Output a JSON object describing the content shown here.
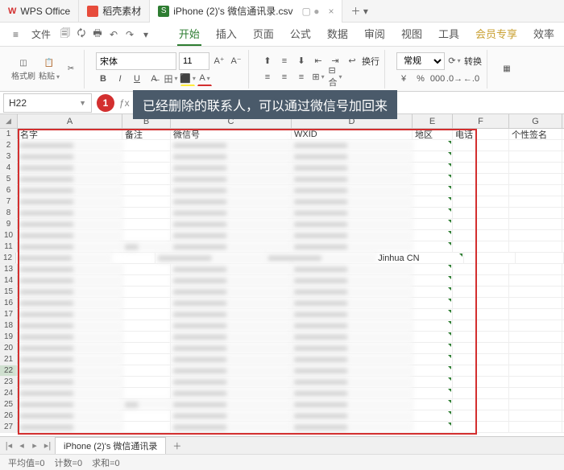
{
  "tabs": {
    "app1": "WPS Office",
    "app2": "稻壳素材",
    "app3_icon": "S",
    "app3": "iPhone (2)'s 微信通讯录.csv",
    "close": "×",
    "tab_icons": "▢ ●",
    "add": "＋"
  },
  "file_menu": {
    "hamburger": "≡",
    "label": "文件"
  },
  "quick_icons": [
    "🗐",
    "🗘",
    "🖶",
    "↶",
    "↷",
    "▾"
  ],
  "menu_tabs": [
    "开始",
    "插入",
    "页面",
    "公式",
    "数据",
    "审阅",
    "视图",
    "工具",
    "会员专享",
    "效率"
  ],
  "ribbon": {
    "fmt_brush": "格式刷",
    "paste": "粘贴",
    "font": "宋体",
    "size": "11",
    "wrap": "换行",
    "general": "常规",
    "transform": "转换"
  },
  "namebox": "H22",
  "badge": "1",
  "hint": "已经删除的联系人，可以通过微信号加回来",
  "columns": [
    "A",
    "B",
    "C",
    "D",
    "E",
    "F",
    "G"
  ],
  "headers": {
    "A": "名字",
    "B": "备注",
    "C": "微信号",
    "D": "WXID",
    "E": "地区",
    "F": "电话",
    "G": "个性签名"
  },
  "row_count": 27,
  "jinhua_row": 12,
  "jinhua_text": "Jinhua CN",
  "sheet": {
    "name": "iPhone (2)'s 微信通讯录",
    "add": "＋",
    "nav": [
      "|◂",
      "◂",
      "▸",
      "▸|"
    ]
  },
  "status": {
    "avg": "平均值=0",
    "cnt": "计数=0",
    "sum": "求和=0"
  }
}
